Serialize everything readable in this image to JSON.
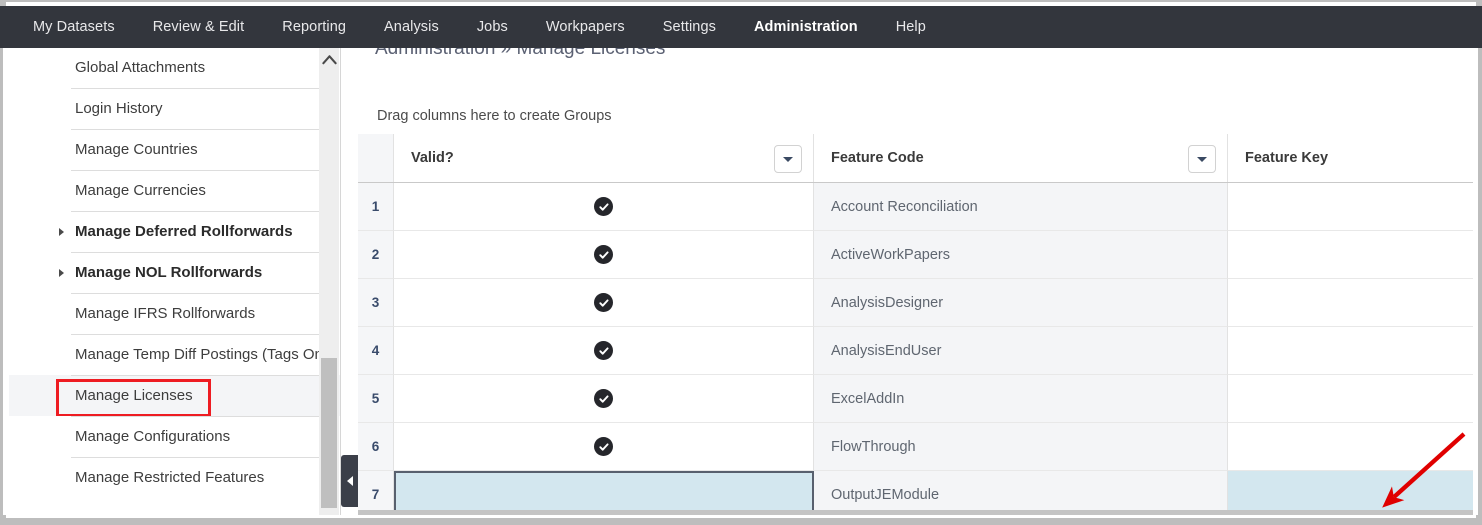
{
  "topnav": {
    "items": [
      {
        "label": "My Datasets",
        "active": false
      },
      {
        "label": "Review & Edit",
        "active": false
      },
      {
        "label": "Reporting",
        "active": false
      },
      {
        "label": "Analysis",
        "active": false
      },
      {
        "label": "Jobs",
        "active": false
      },
      {
        "label": "Workpapers",
        "active": false
      },
      {
        "label": "Settings",
        "active": false
      },
      {
        "label": "Administration",
        "active": true
      },
      {
        "label": "Help",
        "active": false
      }
    ],
    "accent_color": "#f58220",
    "bar_color": "#33363d"
  },
  "sidebar": {
    "items": [
      {
        "label": "Global Attachments",
        "bold": false,
        "caret": false,
        "selected": false,
        "highlighted": false
      },
      {
        "label": "Login History",
        "bold": false,
        "caret": false,
        "selected": false,
        "highlighted": false
      },
      {
        "label": "Manage Countries",
        "bold": false,
        "caret": false,
        "selected": false,
        "highlighted": false
      },
      {
        "label": "Manage Currencies",
        "bold": false,
        "caret": false,
        "selected": false,
        "highlighted": false
      },
      {
        "label": "Manage Deferred Rollforwards",
        "bold": true,
        "caret": true,
        "selected": false,
        "highlighted": false
      },
      {
        "label": "Manage NOL Rollforwards",
        "bold": true,
        "caret": true,
        "selected": false,
        "highlighted": false
      },
      {
        "label": "Manage IFRS Rollforwards",
        "bold": false,
        "caret": false,
        "selected": false,
        "highlighted": false
      },
      {
        "label": "Manage Temp Diff Postings (Tags Only)",
        "bold": false,
        "caret": false,
        "selected": false,
        "highlighted": false
      },
      {
        "label": "Manage Licenses",
        "bold": false,
        "caret": false,
        "selected": true,
        "highlighted": true
      },
      {
        "label": "Manage Configurations",
        "bold": false,
        "caret": false,
        "selected": false,
        "highlighted": false
      },
      {
        "label": "Manage Restricted Features",
        "bold": false,
        "caret": false,
        "selected": false,
        "highlighted": false
      }
    ],
    "highlight_color": "#ee1c22",
    "scroll_up_icon": "chevron-up-icon",
    "collapse_icon": "chevron-left-icon"
  },
  "main": {
    "breadcrumb": "Administration  »  Manage Licenses",
    "group_bar_text": "Drag columns here to create Groups",
    "grid": {
      "columns": [
        {
          "key": "index",
          "label": "",
          "dropdown": false
        },
        {
          "key": "valid",
          "label": "Valid?",
          "dropdown": true
        },
        {
          "key": "code",
          "label": "Feature Code",
          "dropdown": true
        },
        {
          "key": "key",
          "label": "Feature Key",
          "dropdown": false
        }
      ],
      "rows": [
        {
          "index": "1",
          "valid": true,
          "code": "Account Reconciliation",
          "key": "",
          "selected": false
        },
        {
          "index": "2",
          "valid": true,
          "code": "ActiveWorkPapers",
          "key": "",
          "selected": false
        },
        {
          "index": "3",
          "valid": true,
          "code": "AnalysisDesigner",
          "key": "",
          "selected": false
        },
        {
          "index": "4",
          "valid": true,
          "code": "AnalysisEndUser",
          "key": "",
          "selected": false
        },
        {
          "index": "5",
          "valid": true,
          "code": "ExcelAddIn",
          "key": "",
          "selected": false
        },
        {
          "index": "6",
          "valid": true,
          "code": "FlowThrough",
          "key": "",
          "selected": false
        },
        {
          "index": "7",
          "valid": false,
          "code": "OutputJEModule",
          "key": "",
          "selected": true
        }
      ],
      "check_icon": "check-circle-icon",
      "dropdown_icon": "chevron-down-icon",
      "selection_fill": "#d3e7ef"
    }
  },
  "annotation": {
    "arrow_color": "#e00000",
    "arrow_name": "red-annotation-arrow"
  }
}
